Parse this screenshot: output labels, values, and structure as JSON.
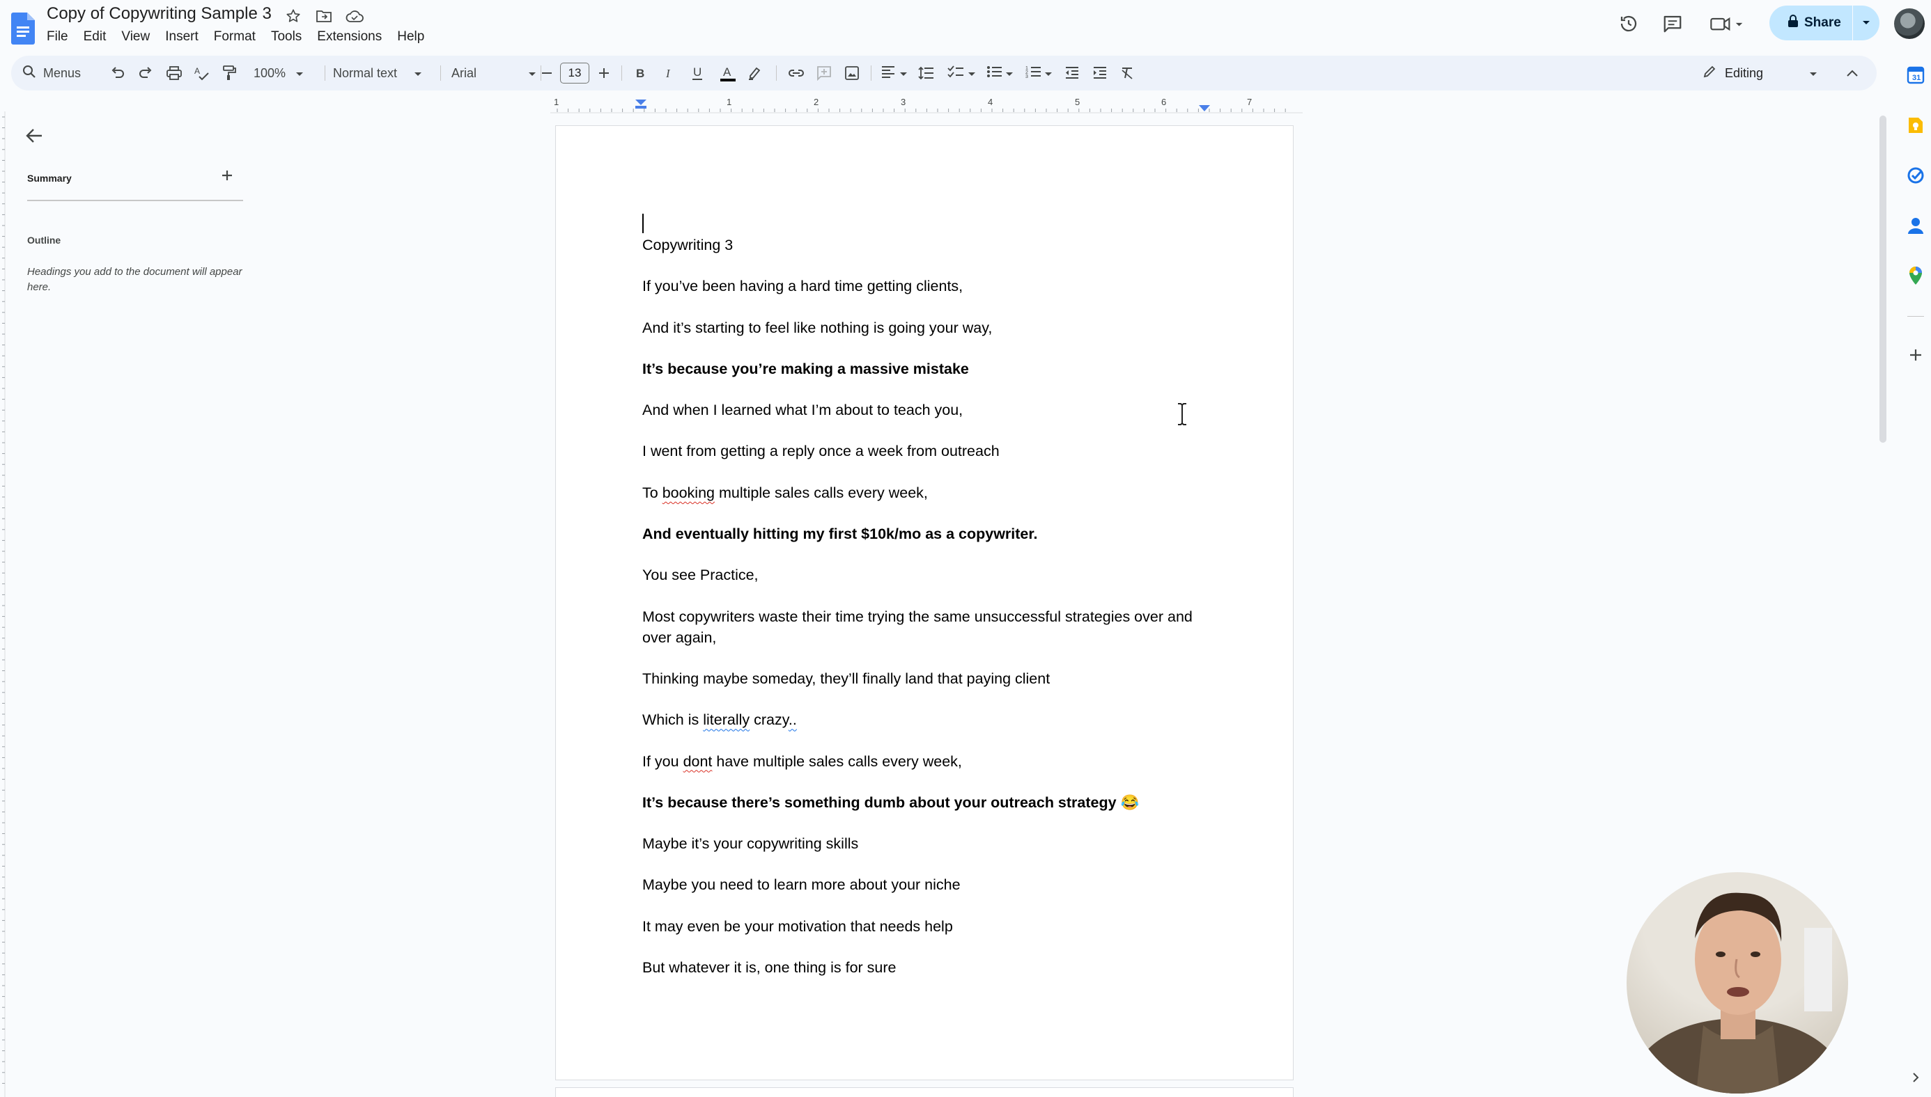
{
  "app": {
    "doc_title": "Copy of Copywriting Sample 3",
    "menu": [
      "File",
      "Edit",
      "View",
      "Insert",
      "Format",
      "Tools",
      "Extensions",
      "Help"
    ],
    "share_label": "Share"
  },
  "toolbar": {
    "menus_label": "Menus",
    "zoom": "100%",
    "style": "Normal text",
    "font": "Arial",
    "font_size": "13",
    "mode": "Editing"
  },
  "ruler": {
    "ticks": [
      "1",
      "1",
      "2",
      "3",
      "4",
      "5",
      "6",
      "7"
    ]
  },
  "left_panel": {
    "summary_label": "Summary",
    "outline_label": "Outline",
    "outline_hint": "Headings you add to the document will appear here."
  },
  "document": {
    "paragraphs": [
      {
        "text": "Copywriting 3",
        "bold": false
      },
      {
        "text": "If you’ve been having a hard time getting clients,",
        "bold": false
      },
      {
        "text": "And it’s starting to feel like nothing is going your way,",
        "bold": false
      },
      {
        "text": "It’s because you’re making a massive mistake",
        "bold": true
      },
      {
        "text": "And when I learned what I’m about to teach you,",
        "bold": false
      },
      {
        "text": "I went from getting a reply once a week from outreach",
        "bold": false
      },
      {
        "text": "To booking multiple sales calls every week,",
        "bold": false
      },
      {
        "text": "And eventually hitting my first $10k/mo as a copywriter.",
        "bold": true
      },
      {
        "text": "You see Practice,",
        "bold": false
      },
      {
        "text": "Most copywriters waste their time trying the same unsuccessful strategies over and over again,",
        "bold": false
      },
      {
        "text": "Thinking maybe someday, they’ll finally land that paying client",
        "bold": false
      },
      {
        "text": "Which is literally crazy..",
        "bold": false
      },
      {
        "text": "If you dont have multiple sales calls every week,",
        "bold": false
      },
      {
        "text": "It’s because there’s something dumb about your outreach strategy 😂",
        "bold": true
      },
      {
        "text": "Maybe it’s your copywriting skills",
        "bold": false
      },
      {
        "text": "Maybe you need to learn more about your niche",
        "bold": false
      },
      {
        "text": "It may even be your motivation that needs help",
        "bold": false
      },
      {
        "text": "But whatever it is, one thing is for sure",
        "bold": false
      }
    ]
  },
  "colors": {
    "accent": "#1a73e8",
    "share_bg": "#c2e7ff",
    "toolbar_bg": "#edf2fa",
    "page_bg": "#f9fbfd"
  }
}
